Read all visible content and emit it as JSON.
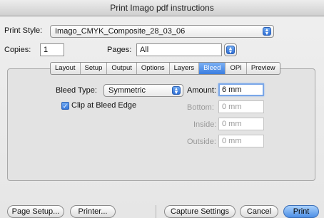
{
  "window": {
    "title": "Print Imago pdf instructions"
  },
  "print_style": {
    "label": "Print Style:",
    "value": "Imago_CMYK_Composite_28_03_06"
  },
  "copies": {
    "label": "Copies:",
    "value": "1"
  },
  "pages": {
    "label": "Pages:",
    "value": "All"
  },
  "tabs": [
    {
      "label": "Layout"
    },
    {
      "label": "Setup"
    },
    {
      "label": "Output"
    },
    {
      "label": "Options"
    },
    {
      "label": "Layers"
    },
    {
      "label": "Bleed",
      "active": true
    },
    {
      "label": "OPI"
    },
    {
      "label": "Preview"
    }
  ],
  "bleed": {
    "type_label": "Bleed Type:",
    "type_value": "Symmetric",
    "amount_label": "Amount:",
    "amount_value": "6 mm",
    "bottom_label": "Bottom:",
    "bottom_value": "0 mm",
    "inside_label": "Inside:",
    "inside_value": "0 mm",
    "outside_label": "Outside:",
    "outside_value": "0 mm",
    "clip_label": "Clip at Bleed Edge",
    "clip_checked": true
  },
  "buttons": {
    "page_setup": "Page Setup...",
    "printer": "Printer...",
    "capture": "Capture Settings",
    "cancel": "Cancel",
    "print": "Print"
  },
  "colors": {
    "accent": "#3a7de0"
  }
}
